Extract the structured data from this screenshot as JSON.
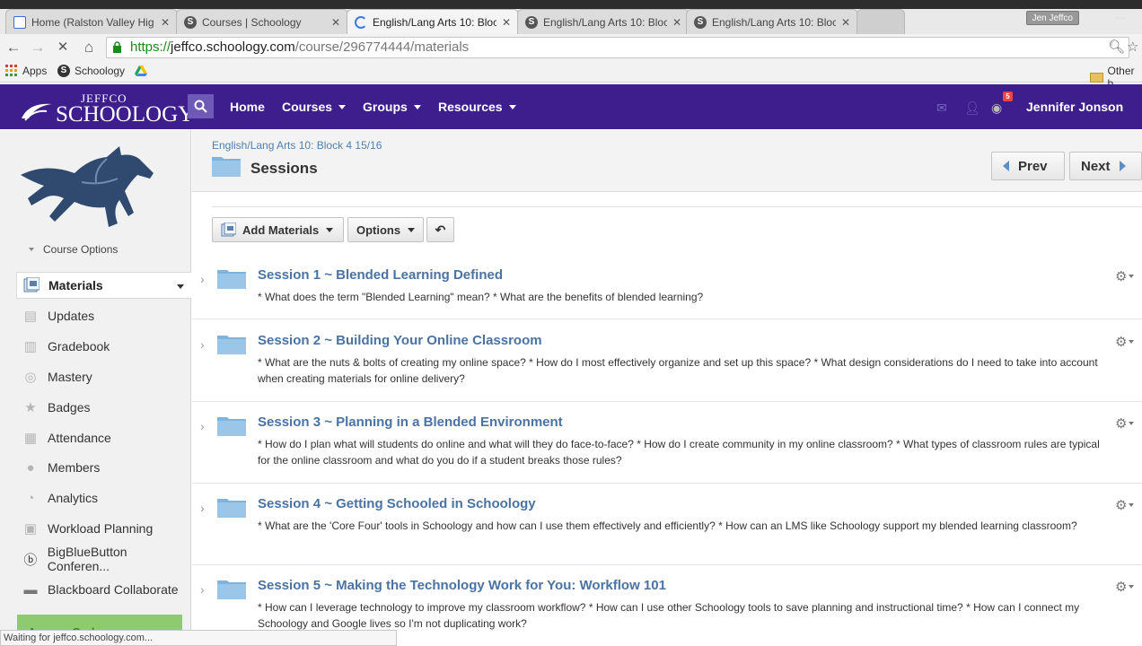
{
  "browser": {
    "tabs": [
      {
        "title": "Home (Ralston Valley Hig",
        "favicon": "doc"
      },
      {
        "title": "Courses | Schoology",
        "favicon": "schoology"
      },
      {
        "title": "English/Lang Arts 10: Bloc",
        "favicon": "loading"
      },
      {
        "title": "English/Lang Arts 10: Bloc",
        "favicon": "schoology"
      },
      {
        "title": "English/Lang Arts 10: Bloc",
        "favicon": "schoology"
      }
    ],
    "profile": "Jen Jeffco",
    "url_scheme": "https://",
    "url_host": "jeffco.schoology.com",
    "url_path": "/course/296774444/materials",
    "bookmarks": [
      "Apps",
      "Schoology"
    ],
    "other_bookmarks": "Other b",
    "status": "Waiting for jeffco.schoology.com..."
  },
  "header": {
    "logo_top": "JEFFCO",
    "logo_main": "SCHOOLOGY",
    "nav": [
      "Home",
      "Courses",
      "Groups",
      "Resources"
    ],
    "notification_count": "5",
    "user_name": "Jennifer Jonson"
  },
  "sidebar": {
    "course_options": "Course Options",
    "items": [
      {
        "label": "Materials",
        "icon": "materials-icon"
      },
      {
        "label": "Updates",
        "icon": "updates-icon"
      },
      {
        "label": "Gradebook",
        "icon": "gradebook-icon"
      },
      {
        "label": "Mastery",
        "icon": "mastery-icon"
      },
      {
        "label": "Badges",
        "icon": "badges-icon"
      },
      {
        "label": "Attendance",
        "icon": "attendance-icon"
      },
      {
        "label": "Members",
        "icon": "members-icon"
      },
      {
        "label": "Analytics",
        "icon": "analytics-icon"
      },
      {
        "label": "Workload Planning",
        "icon": "workload-icon"
      },
      {
        "label": "BigBlueButton Conferen...",
        "icon": "bigbluebutton-icon"
      },
      {
        "label": "Blackboard Collaborate",
        "icon": "blackboard-icon"
      }
    ],
    "access_code": "Access Code"
  },
  "page": {
    "breadcrumb": "English/Lang Arts 10: Block 4 15/16",
    "title": "Sessions",
    "prev": "Prev",
    "next": "Next",
    "add_materials": "Add Materials",
    "options": "Options"
  },
  "sessions": [
    {
      "title": "Session 1 ~ Blended Learning Defined",
      "desc": "* What does the term \"Blended Learning\" mean? * What are the benefits of blended learning?"
    },
    {
      "title": "Session 2 ~ Building Your Online Classroom",
      "desc": "* What are the nuts & bolts of creating my online space? * How do I most effectively organize and set up this space? * What design considerations do I need to take into account when creating materials for online delivery?"
    },
    {
      "title": "Session 3 ~ Planning in a Blended Environment",
      "desc": "* How do I plan what will students do online and what will they do face-to-face? * How do I create community in my online classroom? * What types of classroom rules are typical for the online classroom and what do you do if a student breaks those rules?"
    },
    {
      "title": "Session 4 ~ Getting Schooled in Schoology",
      "desc": "* What are the 'Core Four' tools in Schoology and how can I use them effectively and efficiently? * How can an LMS like Schoology support my blended learning classroom?"
    },
    {
      "title": "Session 5 ~ Making the Technology Work for You: Workflow 101",
      "desc": "* How can I leverage technology to improve my classroom workflow? * How can I use other Schoology tools to save planning and instructional time? * How can I connect my Schoology and Google lives so I'm not duplicating work?"
    }
  ],
  "colors": {
    "header": "#3d1e8c",
    "link": "#4a73a4",
    "folder": "#7fb3dc"
  }
}
